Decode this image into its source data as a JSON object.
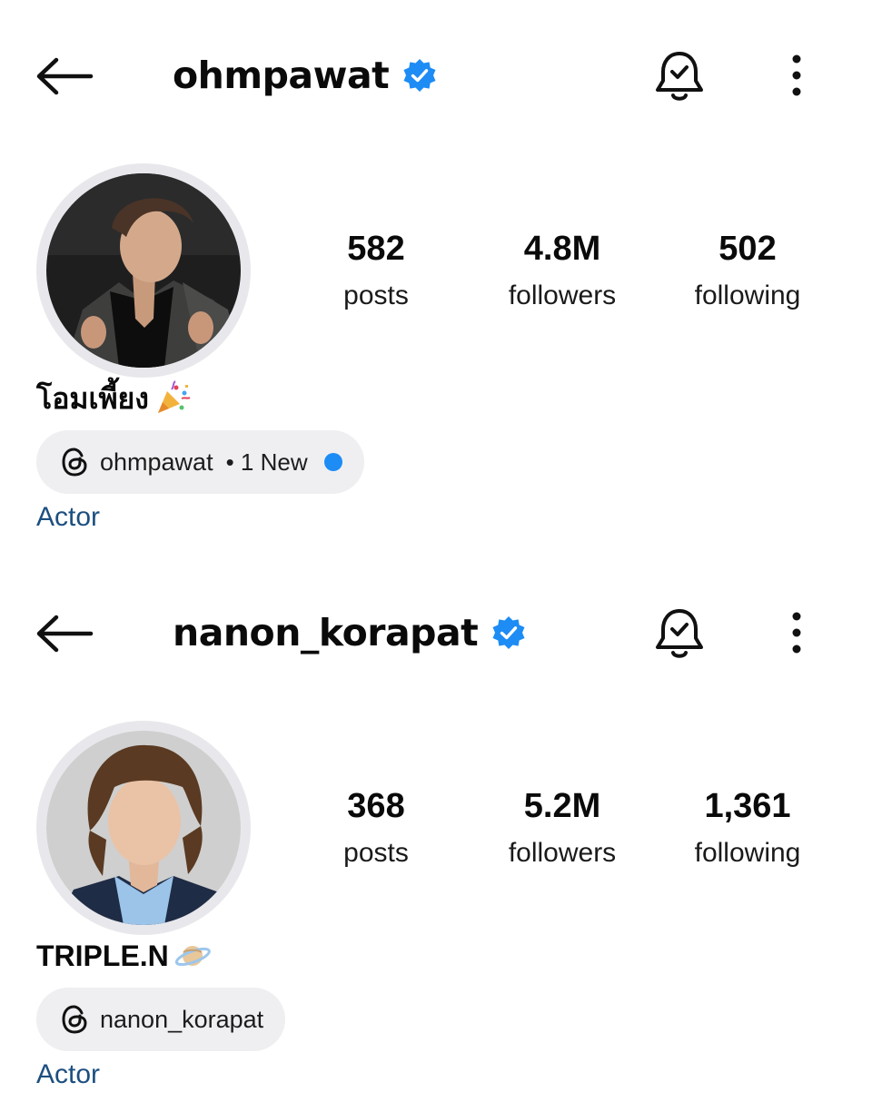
{
  "profiles": [
    {
      "username": "ohmpawat",
      "stats": {
        "posts": "582",
        "posts_label": "posts",
        "followers": "4.8M",
        "followers_label": "followers",
        "following": "502",
        "following_label": "following"
      },
      "display_name": "โอมเพี้ยง",
      "display_emoji": "party-popper-icon",
      "threads_handle": "ohmpawat",
      "threads_new": "• 1 New",
      "category": "Actor"
    },
    {
      "username": "nanon_korapat",
      "stats": {
        "posts": "368",
        "posts_label": "posts",
        "followers": "5.2M",
        "followers_label": "followers",
        "following": "1,361",
        "following_label": "following"
      },
      "display_name": "TRIPLE.N",
      "display_emoji": "ringed-planet-icon",
      "threads_handle": "nanon_korapat",
      "threads_new": "",
      "category": "Actor"
    }
  ],
  "colors": {
    "verified": "#1d8cf5",
    "category_link": "#1c4f80",
    "pill_bg": "#efeff2"
  }
}
